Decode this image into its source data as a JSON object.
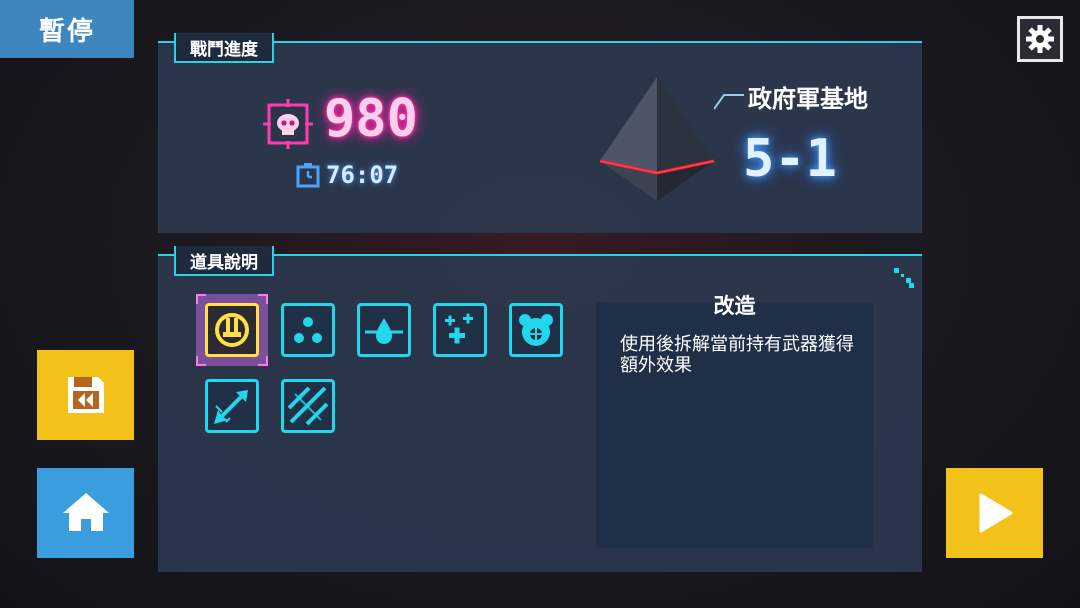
{
  "header": {
    "pause_label": "暫停"
  },
  "battle_progress": {
    "tab_label": "戰鬥進度",
    "kill_count": "980",
    "time": "76:07",
    "stage_name": "政府軍基地",
    "stage_number": "5-1"
  },
  "item_info": {
    "tab_label": "道具說明",
    "items": [
      {
        "icon": "gear-tool-icon",
        "selected": true
      },
      {
        "icon": "dots-icon",
        "selected": false
      },
      {
        "icon": "droplet-icon",
        "selected": false
      },
      {
        "icon": "crosses-icon",
        "selected": false
      },
      {
        "icon": "bear-target-icon",
        "selected": false
      },
      {
        "icon": "arrow-burst-icon",
        "selected": false
      },
      {
        "icon": "slash-pattern-icon",
        "selected": false
      }
    ],
    "selected_title": "改造",
    "selected_description": "使用後拆解當前持有武器獲得額外效果"
  },
  "colors": {
    "accent_cyan": "#22d6ec",
    "score_pink": "#ff3ab4",
    "button_yellow": "#f2c21a",
    "button_blue": "#3a9ede"
  }
}
